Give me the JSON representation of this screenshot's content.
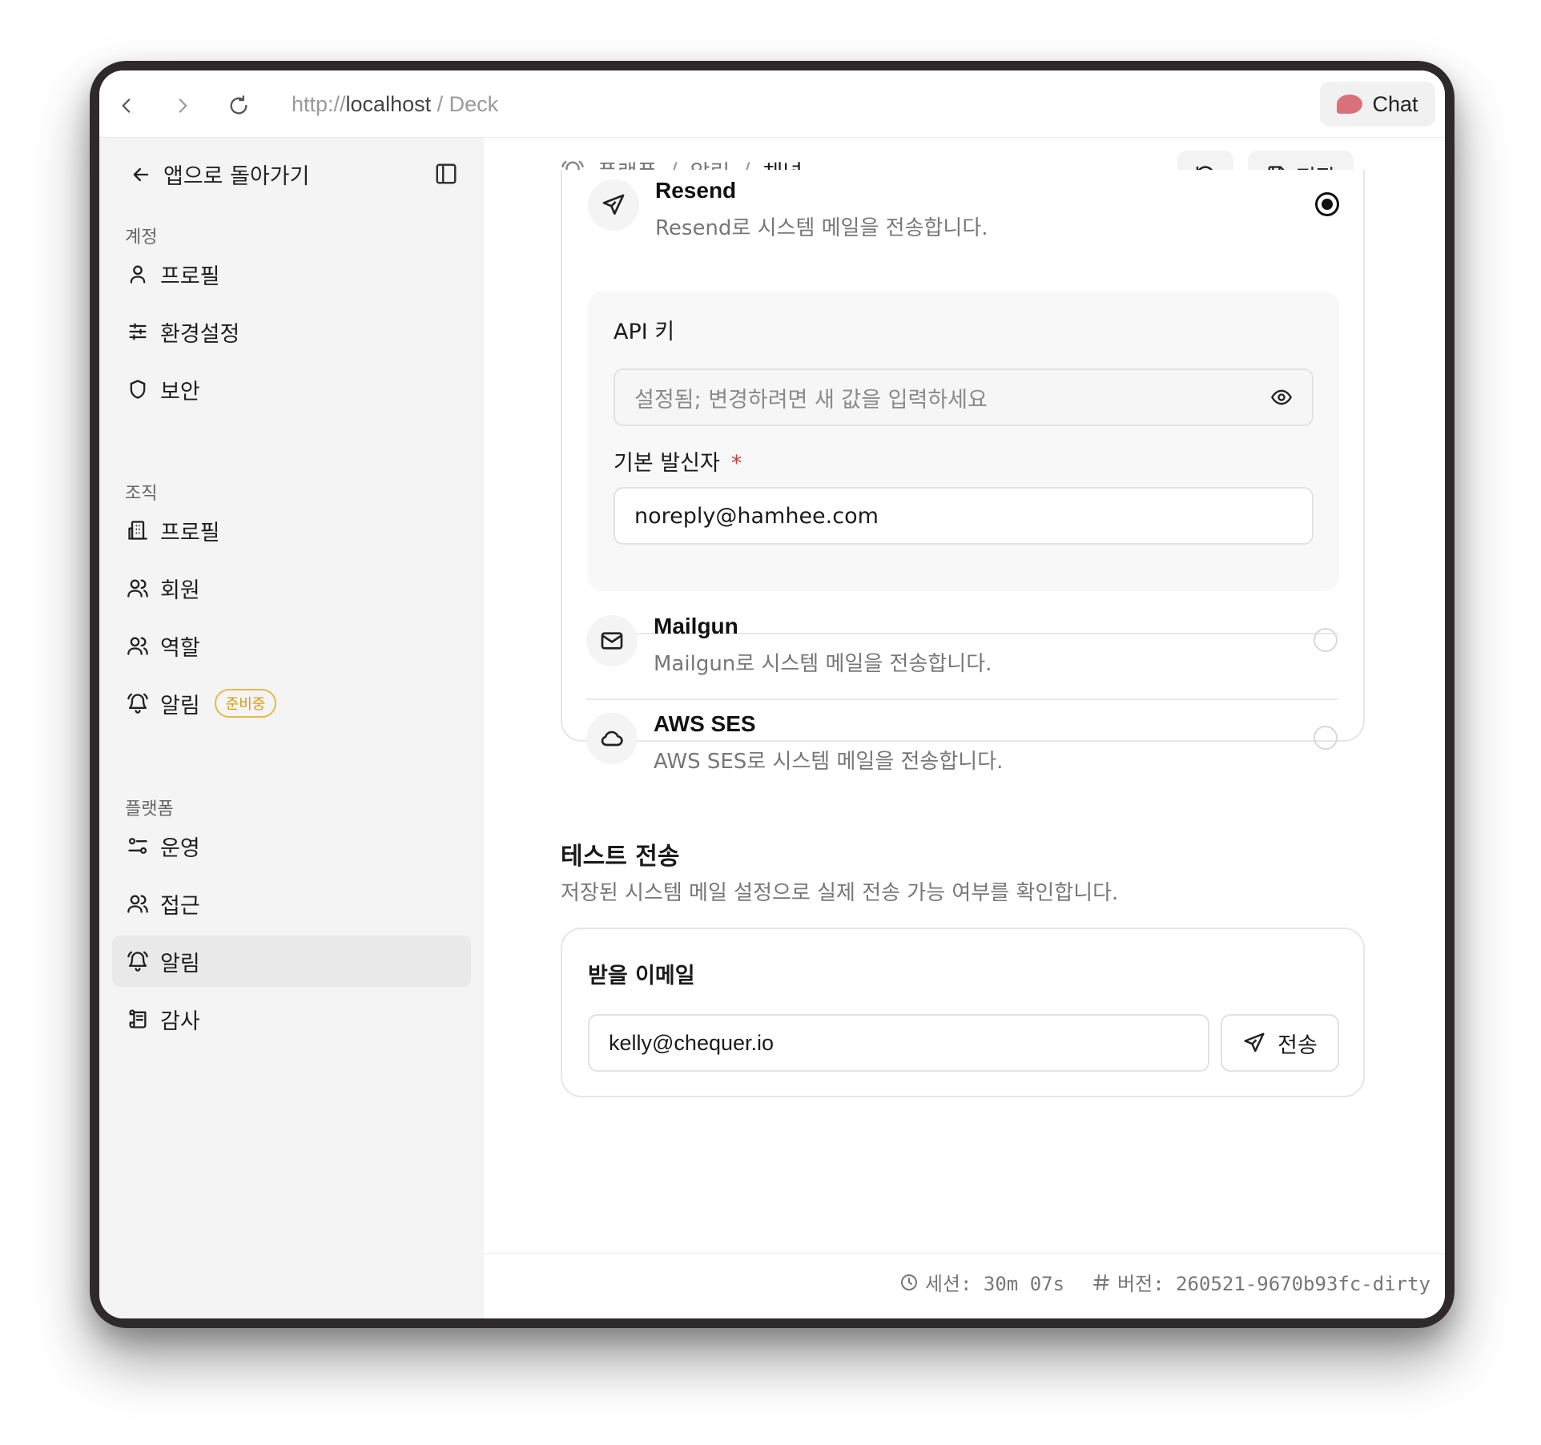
{
  "browser": {
    "url_scheme": "http://",
    "url_host": "localhost",
    "url_sep": " / ",
    "url_page": "Deck",
    "chat_label": "Chat"
  },
  "sidebar": {
    "back_label": "앱으로 돌아가기",
    "sections": [
      {
        "title": "계정",
        "items": [
          {
            "label": "프로필",
            "icon": "user-icon"
          },
          {
            "label": "환경설정",
            "icon": "sliders-icon"
          },
          {
            "label": "보안",
            "icon": "shield-icon"
          }
        ]
      },
      {
        "title": "조직",
        "items": [
          {
            "label": "프로필",
            "icon": "building-icon"
          },
          {
            "label": "회원",
            "icon": "users-icon"
          },
          {
            "label": "역할",
            "icon": "users-icon"
          },
          {
            "label": "알림",
            "icon": "bell-icon",
            "badge": "준비중"
          }
        ]
      },
      {
        "title": "플랫폼",
        "items": [
          {
            "label": "운영",
            "icon": "toggles-icon"
          },
          {
            "label": "접근",
            "icon": "users-icon"
          },
          {
            "label": "알림",
            "icon": "bell-icon",
            "active": true
          },
          {
            "label": "감사",
            "icon": "scroll-icon"
          }
        ]
      }
    ]
  },
  "breadcrumb": {
    "items": [
      "플랫폼",
      "알림",
      "채널"
    ],
    "separator": "/"
  },
  "toolbar": {
    "save_label": "저장"
  },
  "providers": [
    {
      "name": "Resend",
      "description": "Resend로 시스템 메일을 전송합니다.",
      "selected": true,
      "icon": "send-icon"
    },
    {
      "name": "Mailgun",
      "description": "Mailgun로 시스템 메일을 전송합니다.",
      "selected": false,
      "icon": "mail-icon"
    },
    {
      "name": "AWS SES",
      "description": "AWS SES로 시스템 메일을 전송합니다.",
      "selected": false,
      "icon": "cloud-icon"
    }
  ],
  "config": {
    "api_key_label": "API 키",
    "api_key_placeholder": "설정됨; 변경하려면 새 값을 입력하세요",
    "sender_label": "기본 발신자",
    "required_mark": "*",
    "sender_value": "noreply@hamhee.com"
  },
  "test_send": {
    "title": "테스트 전송",
    "description": "저장된 시스템 메일 설정으로 실제 전송 가능 여부를 확인합니다.",
    "recipient_label": "받을 이메일",
    "recipient_value": "kelly@chequer.io",
    "send_label": "전송"
  },
  "footer": {
    "session": "세션: 30m 07s",
    "version": "버전: 260521-9670b93fc-dirty"
  },
  "colors": {
    "badge": "#d99a16",
    "required": "#d23b3b",
    "chat_accent": "#d9707c"
  }
}
